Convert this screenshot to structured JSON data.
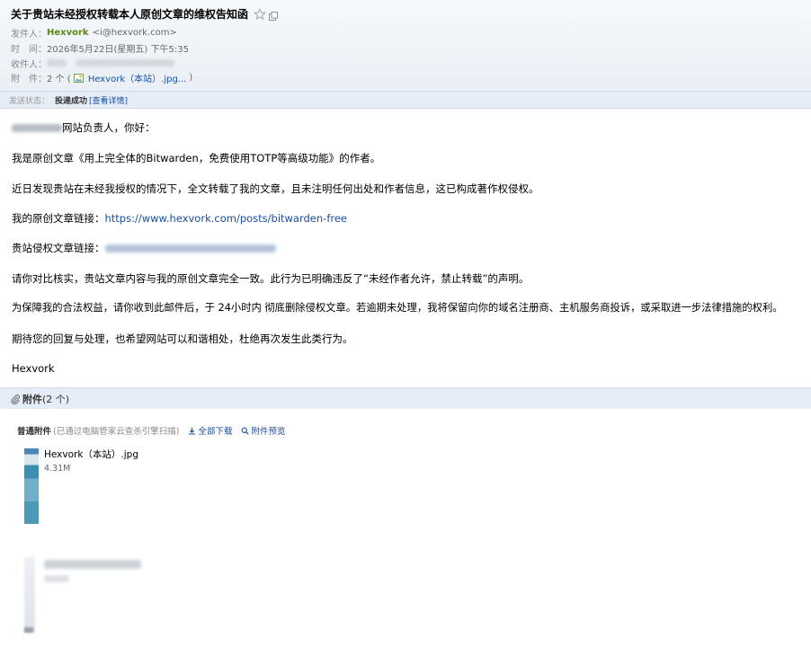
{
  "header": {
    "subject": "关于贵站未经授权转载本人原创文章的维权告知函",
    "from_label": "发件人：",
    "sender_name": "Hexvork",
    "sender_email": "<i@hexvork.com>",
    "time_label": "时　间：",
    "time_value": "2026年5月22日(星期五) 下午5:35",
    "to_label": "收件人：",
    "attach_label": "附　件：",
    "attach_count": "2 个 (",
    "attach_file": "Hexvork（本站）.jpg...",
    "attach_close": ")"
  },
  "status": {
    "label": "发送状态：",
    "value": "投递成功",
    "detail": "[查看详情]"
  },
  "body": {
    "greeting": "网站负责人，你好：",
    "p1": "我是原创文章《用上完全体的Bitwarden，免费使用TOTP等高级功能》的作者。",
    "p2": "近日发现贵站在未经我授权的情况下，全文转载了我的文章，且未注明任何出处和作者信息，这已构成著作权侵权。",
    "p3_label": "我的原创文章链接：",
    "p3_link": "https://www.hexvork.com/posts/bitwarden-free",
    "p4_label": "贵站侵权文章链接：",
    "p5": "请你对比核实，贵站文章内容与我的原创文章完全一致。此行为已明确违反了“未经作者允许，禁止转载”的声明。",
    "p6": "为保障我的合法权益，请你收到此邮件后，于 24小时内 彻底删除侵权文章。若逾期未处理，我将保留向你的域名注册商、主机服务商投诉，或采取进一步法律措施的权利。",
    "p7": "期待您的回复与处理，也希望网站可以和谐相处，杜绝再次发生此类行为。",
    "signature": "Hexvork"
  },
  "attachments": {
    "title": "附件",
    "count": "(2 个)",
    "tools_label": "普通附件",
    "tools_note": "(已通过电脑管家云查杀引擎扫描)",
    "download_all": "全部下载",
    "preview": "附件预览",
    "files": [
      {
        "name": "Hexvork（本站）.jpg",
        "size": "4.31M"
      }
    ]
  },
  "colors": {
    "link": "#1a4fa0",
    "sender": "#5a8a12",
    "header_bg": "#e9eff6",
    "attach_bar": "#e3ecf7"
  },
  "icons": [
    "star-icon",
    "popout-icon",
    "jpg-icon",
    "paperclip-icon",
    "download-icon",
    "search-icon"
  ]
}
